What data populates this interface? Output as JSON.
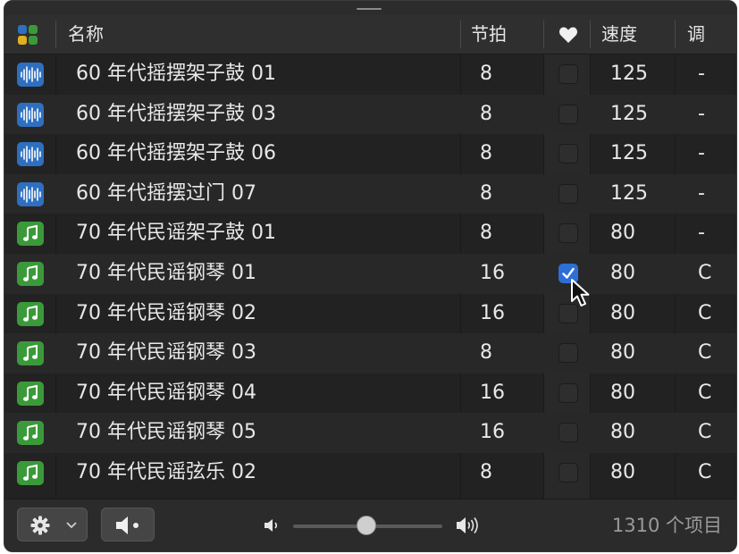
{
  "header": {
    "type_icon": "category-grid-icon",
    "name_label": "名称",
    "beats_label": "节拍",
    "fav_icon": "heart-icon",
    "tempo_label": "速度",
    "key_label": "调"
  },
  "rows": [
    {
      "type": "audio",
      "name": "60 年代摇摆架子鼓 01",
      "beats": "8",
      "fav": false,
      "tempo": "125",
      "key": "-"
    },
    {
      "type": "audio",
      "name": "60 年代摇摆架子鼓 03",
      "beats": "8",
      "fav": false,
      "tempo": "125",
      "key": "-"
    },
    {
      "type": "audio",
      "name": "60 年代摇摆架子鼓 06",
      "beats": "8",
      "fav": false,
      "tempo": "125",
      "key": "-"
    },
    {
      "type": "audio",
      "name": "60 年代摇摆过门 07",
      "beats": "8",
      "fav": false,
      "tempo": "125",
      "key": "-"
    },
    {
      "type": "midi",
      "name": "70 年代民谣架子鼓 01",
      "beats": "8",
      "fav": false,
      "tempo": "80",
      "key": "-"
    },
    {
      "type": "midi",
      "name": "70 年代民谣钢琴 01",
      "beats": "16",
      "fav": true,
      "tempo": "80",
      "key": "C"
    },
    {
      "type": "midi",
      "name": "70 年代民谣钢琴 02",
      "beats": "16",
      "fav": false,
      "tempo": "80",
      "key": "C"
    },
    {
      "type": "midi",
      "name": "70 年代民谣钢琴 03",
      "beats": "8",
      "fav": false,
      "tempo": "80",
      "key": "C"
    },
    {
      "type": "midi",
      "name": "70 年代民谣钢琴 04",
      "beats": "16",
      "fav": false,
      "tempo": "80",
      "key": "C"
    },
    {
      "type": "midi",
      "name": "70 年代民谣钢琴 05",
      "beats": "16",
      "fav": false,
      "tempo": "80",
      "key": "C"
    },
    {
      "type": "midi",
      "name": "70 年代民谣弦乐 02",
      "beats": "8",
      "fav": false,
      "tempo": "80",
      "key": "C"
    }
  ],
  "footer": {
    "settings_icon": "gear-icon",
    "preview_icon": "speaker-icon",
    "volume_low_icon": "volume-low-icon",
    "volume_high_icon": "volume-high-icon",
    "volume_level": 0.5,
    "item_count": "1310 个项目"
  },
  "colors": {
    "audio_icon": "#2f6fbf",
    "midi_icon": "#3a9a3a",
    "checkbox_on": "#2d6fd6"
  }
}
